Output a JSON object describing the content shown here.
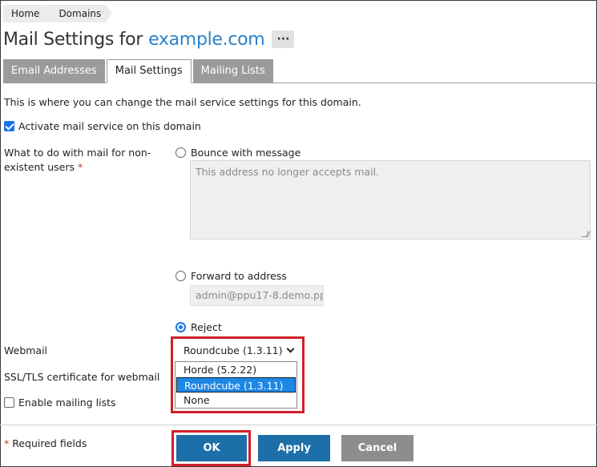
{
  "breadcrumb": [
    "Home",
    "Domains"
  ],
  "header": {
    "title": "Mail Settings for",
    "domain": "example.com",
    "more_label": "···"
  },
  "tabs": [
    {
      "label": "Email Addresses",
      "active": false
    },
    {
      "label": "Mail Settings",
      "active": true
    },
    {
      "label": "Mailing Lists",
      "active": false
    }
  ],
  "intro_text": "This is where you can change the mail service settings for this domain.",
  "activate_mail": {
    "label": "Activate mail service on this domain",
    "checked": true
  },
  "nonexistent": {
    "label": "What to do with mail for non-existent users",
    "required_mark": "*",
    "options": {
      "bounce": {
        "label": "Bounce with message",
        "selected": false
      },
      "bounce_message": "This address no longer accepts mail.",
      "forward": {
        "label": "Forward to address",
        "selected": false
      },
      "forward_address": "admin@ppu17-8.demo.pp",
      "reject": {
        "label": "Reject",
        "selected": true
      }
    }
  },
  "webmail": {
    "label": "Webmail",
    "selected": "Roundcube (1.3.11)",
    "options": [
      "Horde (5.2.22)",
      "Roundcube (1.3.11)",
      "None"
    ]
  },
  "ssl_label": "SSL/TLS certificate for webmail",
  "mailing_lists": {
    "label": "Enable mailing lists",
    "checked": false
  },
  "footer": {
    "required_mark": "*",
    "required_note": "Required fields",
    "ok": "OK",
    "apply": "Apply",
    "cancel": "Cancel"
  },
  "colors": {
    "accent": "#1c6fa8",
    "link": "#2b82c9",
    "highlight": "#d0202a",
    "selected_option": "#1e88e5"
  }
}
